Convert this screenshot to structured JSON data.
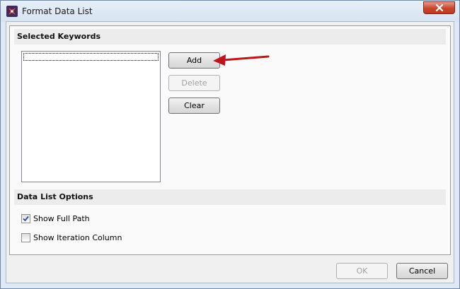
{
  "window": {
    "title": "Format Data List",
    "close_label": "✕"
  },
  "selected_keywords": {
    "header": "Selected Keywords",
    "items": [],
    "buttons": {
      "add": "Add",
      "delete": "Delete",
      "clear": "Clear"
    }
  },
  "data_list_options": {
    "header": "Data List Options",
    "show_full_path": {
      "label": "Show Full Path",
      "checked": true
    },
    "show_iteration_column": {
      "label": "Show Iteration Column",
      "checked": false
    }
  },
  "footer": {
    "ok": "OK",
    "cancel": "Cancel"
  },
  "colors": {
    "annotation_arrow": "#c0141c",
    "close_button": "#c7432c",
    "title_bar": "#dfe9f5"
  },
  "icons": {
    "app": "flow-logo-icon",
    "close": "close-icon",
    "check": "checkmark-icon",
    "annotation": "red-arrow-icon"
  }
}
